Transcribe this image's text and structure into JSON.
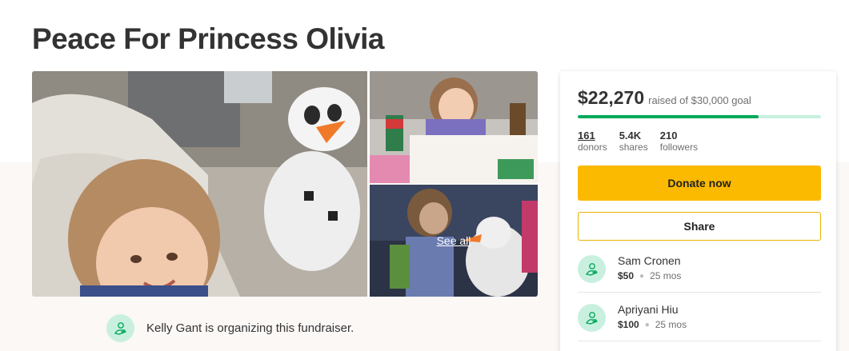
{
  "title": "Peace For Princess Olivia",
  "gallery": {
    "see_all": "See all"
  },
  "organizer": {
    "text": "Kelly Gant is organizing this fundraiser."
  },
  "donation": {
    "amount": "$22,270",
    "goal_text": "raised of $30,000 goal",
    "progress_fraction": 0.742,
    "stats": [
      {
        "value": "161",
        "label": "donors"
      },
      {
        "value": "5.4K",
        "label": "shares"
      },
      {
        "value": "210",
        "label": "followers"
      }
    ],
    "donate_label": "Donate now",
    "share_label": "Share",
    "donors": [
      {
        "name": "Sam Cronen",
        "amount": "$50",
        "time": "25 mos"
      },
      {
        "name": "Apriyani Hiu",
        "amount": "$100",
        "time": "25 mos"
      }
    ]
  },
  "colors": {
    "accent_green": "#02a95c",
    "progress_track": "#c9f0df",
    "donate_yellow": "#fbb900",
    "avatar_bg": "#c9f0df"
  },
  "icons": {
    "avatar": "heart-hand-icon"
  }
}
